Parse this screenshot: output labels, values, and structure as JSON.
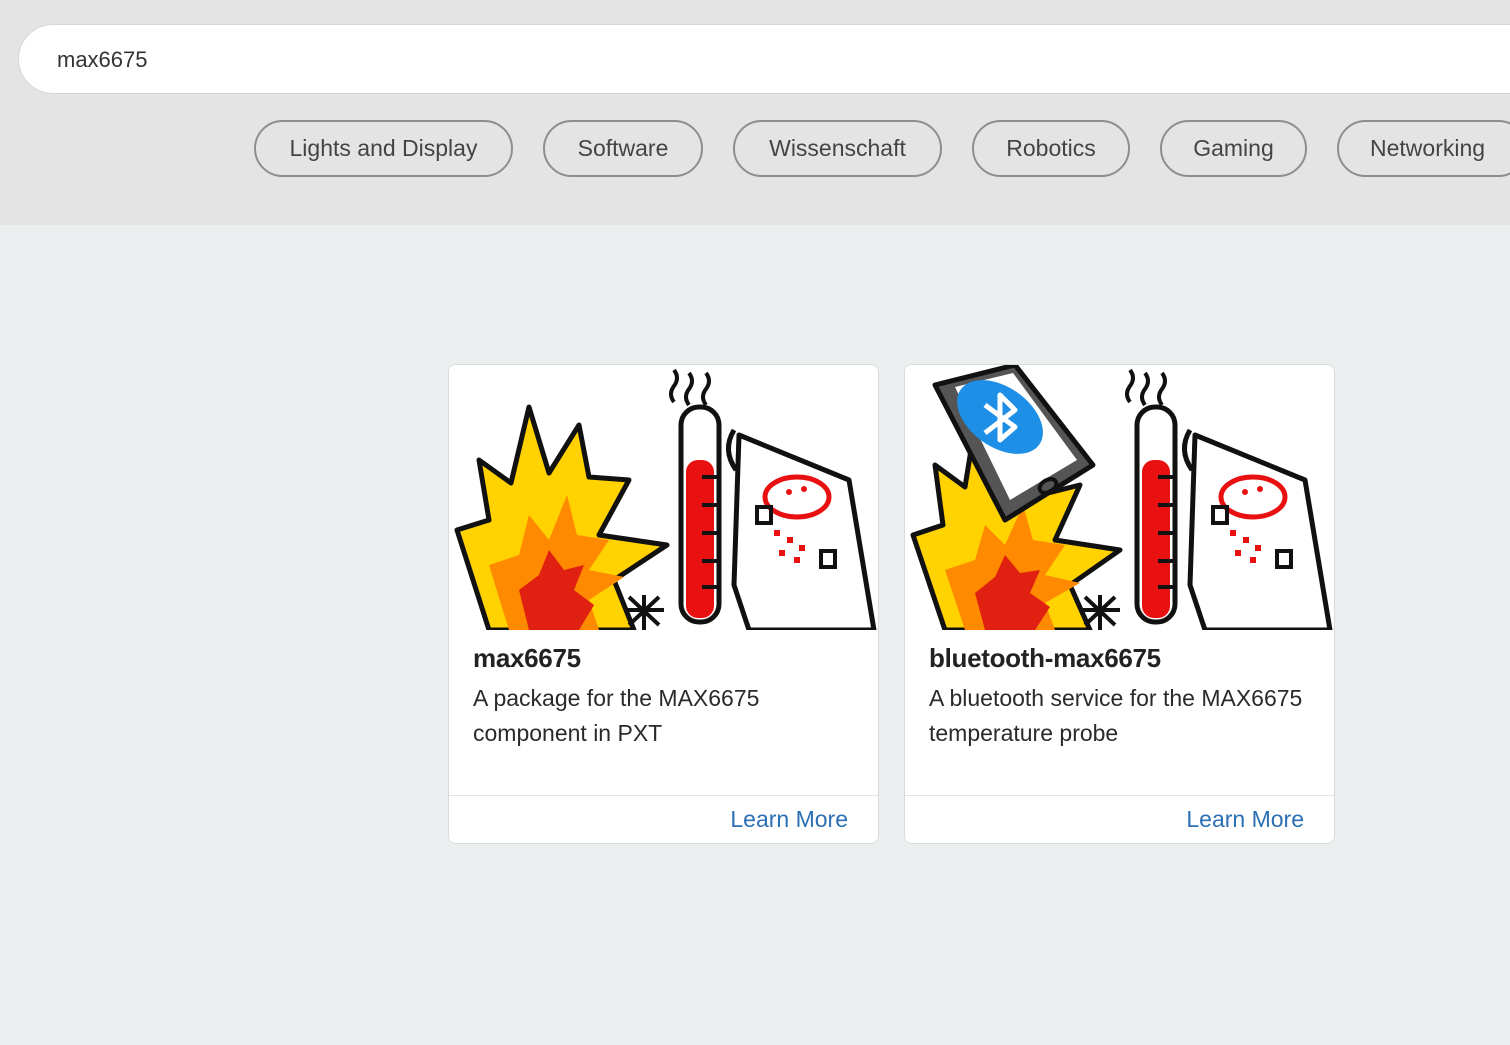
{
  "search": {
    "value": "max6675",
    "placeholder": ""
  },
  "categories": [
    "Lights and Display",
    "Software",
    "Wissenschaft",
    "Robotics",
    "Gaming",
    "Networking"
  ],
  "cards": [
    {
      "title": "max6675",
      "description": "A package for the MAX6675 component in PXT",
      "action": "Learn More",
      "image": "fire-thermometer-microbit-illustration"
    },
    {
      "title": "bluetooth-max6675",
      "description": "A bluetooth service for the MAX6675 temperature probe",
      "action": "Learn More",
      "image": "fire-thermometer-microbit-phone-bluetooth-illustration"
    }
  ],
  "colors": {
    "header_bg": "#E4E4E4",
    "page_bg": "#ECEFF0",
    "link": "#2C6FB5",
    "bluetooth": "#1E8FE6"
  }
}
